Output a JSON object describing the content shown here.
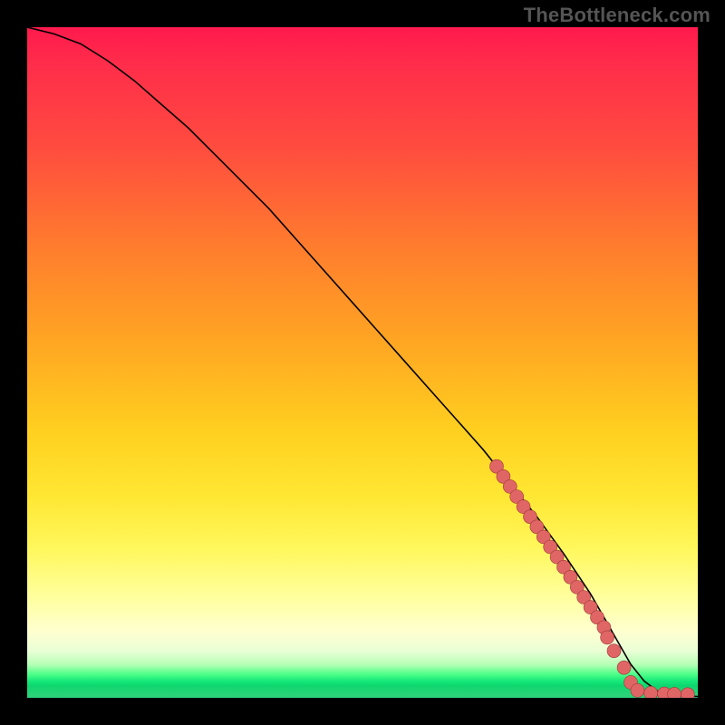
{
  "watermark": "TheBottleneck.com",
  "colors": {
    "background": "#000000",
    "point_fill": "#e06666",
    "point_stroke": "#a03838",
    "curve": "#000000"
  },
  "chart_data": {
    "type": "line",
    "title": "",
    "xlabel": "",
    "ylabel": "",
    "xlim": [
      0,
      100
    ],
    "ylim": [
      0,
      100
    ],
    "series": [
      {
        "name": "bottleneck-curve",
        "x": [
          0,
          4,
          8,
          12,
          16,
          20,
          24,
          28,
          32,
          36,
          40,
          44,
          48,
          52,
          56,
          60,
          64,
          68,
          72,
          76,
          80,
          82,
          84,
          86,
          88,
          90,
          92,
          94,
          96,
          98,
          100
        ],
        "y": [
          100,
          99,
          97.5,
          95,
          92,
          88.5,
          85,
          81,
          77,
          73,
          68.5,
          64,
          59.5,
          55,
          50.5,
          46,
          41.5,
          37,
          32,
          27,
          21.5,
          18.5,
          15.5,
          12,
          8.5,
          5,
          2.5,
          1,
          0.5,
          0.3,
          0.2
        ]
      }
    ],
    "points": {
      "name": "highlighted-segment",
      "x": [
        70,
        71,
        72,
        73,
        74,
        75,
        76,
        77,
        78,
        79,
        80,
        81,
        82,
        83,
        84,
        85,
        86,
        86.5,
        87.5,
        89,
        90,
        91,
        93,
        95,
        96.5,
        98.5
      ],
      "y": [
        34.5,
        33,
        31.5,
        30,
        28.5,
        27,
        25.5,
        24,
        22.5,
        21,
        19.5,
        18,
        16.5,
        15,
        13.5,
        12,
        10.5,
        9,
        7,
        4.5,
        2.3,
        1.1,
        0.7,
        0.6,
        0.55,
        0.5
      ]
    }
  }
}
